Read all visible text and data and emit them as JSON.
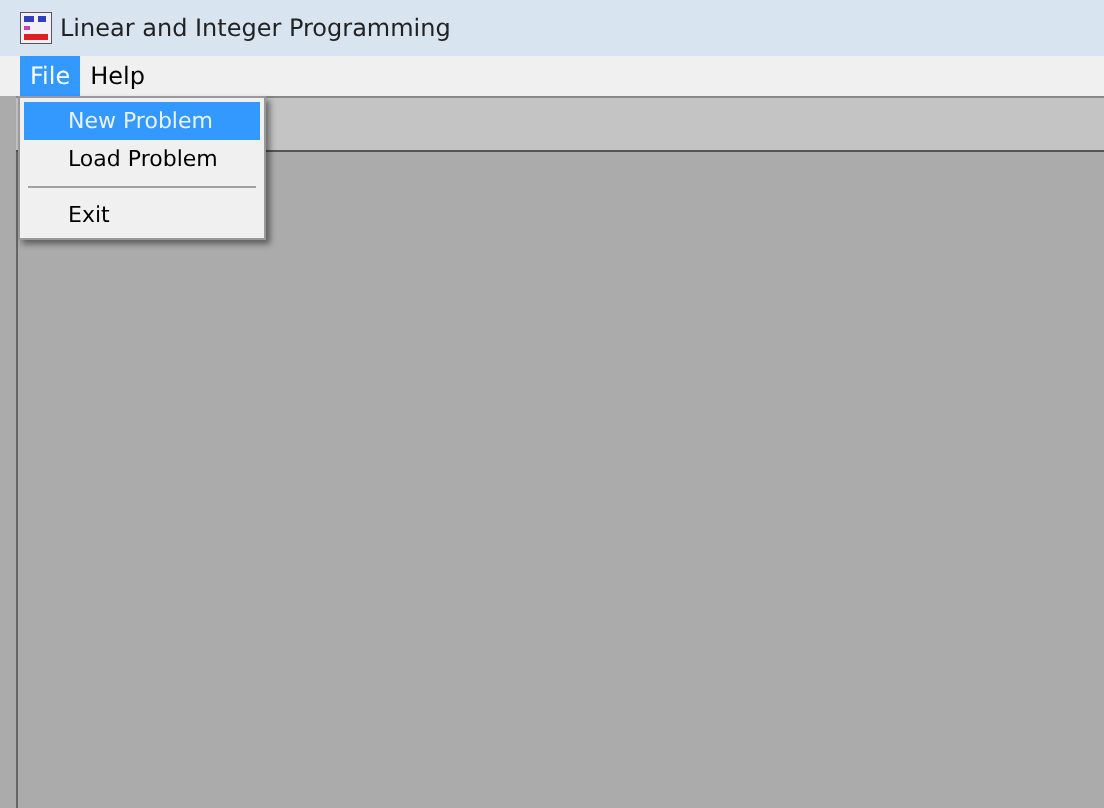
{
  "window": {
    "title": "Linear and Integer Programming"
  },
  "menu_bar": [
    {
      "label": "File",
      "selected": true
    },
    {
      "label": "Help",
      "selected": false
    }
  ],
  "file_menu": {
    "items": [
      {
        "kind": "item",
        "label": "New Problem",
        "selected": true
      },
      {
        "kind": "item",
        "label": "Load Problem",
        "selected": false
      },
      {
        "kind": "separator"
      },
      {
        "kind": "item",
        "label": "Exit",
        "selected": false
      }
    ]
  }
}
